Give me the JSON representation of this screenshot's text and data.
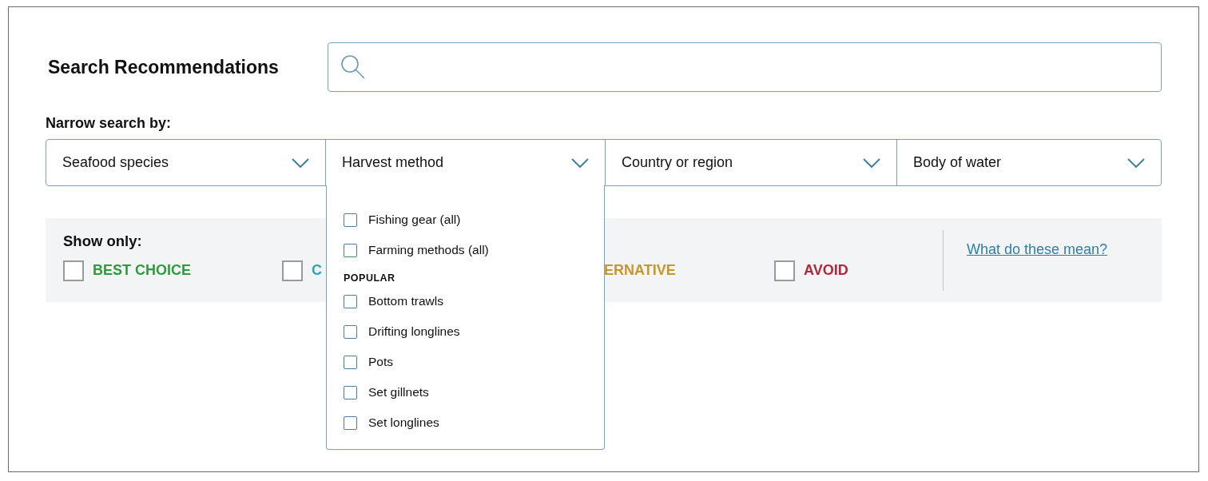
{
  "title": "Search Recommendations",
  "narrow_label": "Narrow search by:",
  "dropdowns": [
    {
      "label": "Seafood species",
      "expanded": false
    },
    {
      "label": "Harvest method",
      "expanded": true,
      "options": [
        {
          "kind": "option",
          "label": "Fishing gear (all)",
          "checked": false
        },
        {
          "kind": "option",
          "label": "Farming methods (all)",
          "checked": false
        },
        {
          "kind": "heading",
          "label": "POPULAR"
        },
        {
          "kind": "option",
          "label": "Bottom trawls",
          "checked": false
        },
        {
          "kind": "option",
          "label": "Drifting longlines",
          "checked": false
        },
        {
          "kind": "option",
          "label": "Pots",
          "checked": false
        },
        {
          "kind": "option",
          "label": "Set gillnets",
          "checked": false
        },
        {
          "kind": "option",
          "label": "Set longlines",
          "checked": false
        }
      ]
    },
    {
      "label": "Country or region",
      "expanded": false
    },
    {
      "label": "Body of water",
      "expanded": false
    }
  ],
  "show_only": {
    "label": "Show only:",
    "filters": [
      {
        "label": "BEST CHOICE",
        "color": "#2e9a3e",
        "checked": false
      },
      {
        "label": "C",
        "color": "#2aa3b5",
        "checked": false
      },
      {
        "label": "ERNATIVE",
        "color": "#c8962a"
      },
      {
        "label": "AVOID",
        "color": "#b3263c",
        "checked": false
      }
    ],
    "link": "What do these mean?"
  }
}
